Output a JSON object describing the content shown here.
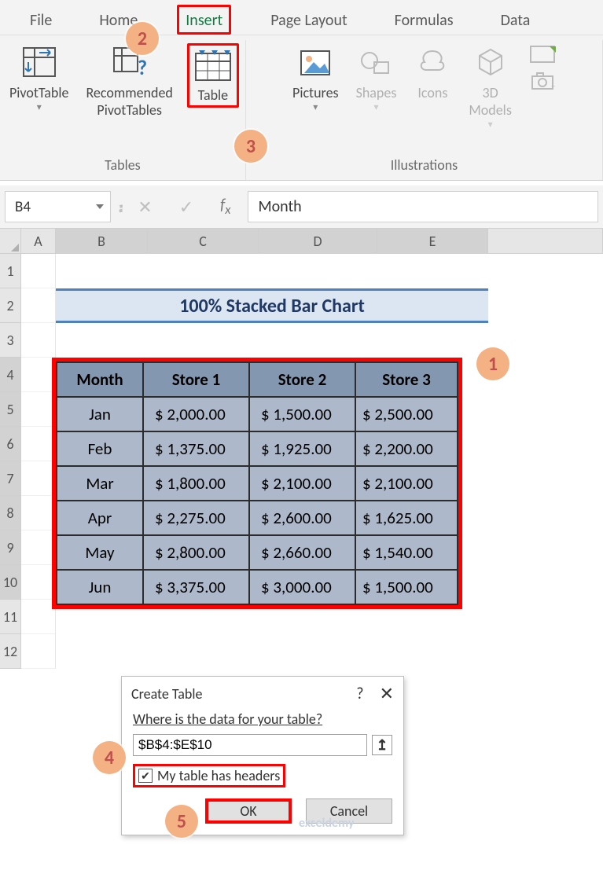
{
  "tabs": {
    "file": "File",
    "home": "Home",
    "insert": "Insert",
    "page_layout": "Page Layout",
    "formulas": "Formulas",
    "data": "Data"
  },
  "ribbon": {
    "tables_group_label": "Tables",
    "illustrations_group_label": "Illustrations",
    "pivot_table": "PivotTable",
    "recommended_pivot": "Recommended\nPivotTables",
    "table": "Table",
    "pictures": "Pictures",
    "shapes": "Shapes",
    "icons": "Icons",
    "models3d": "3D\nModels"
  },
  "name_box": "B4",
  "formula_value": "Month",
  "columns": {
    "A": "A",
    "B": "B",
    "C": "C",
    "D": "D",
    "E": "E"
  },
  "row_numbers": [
    "1",
    "2",
    "3",
    "4",
    "5",
    "6",
    "7",
    "8",
    "9",
    "10",
    "11",
    "12"
  ],
  "title": "100% Stacked Bar Chart",
  "table_headers": [
    "Month",
    "Store 1",
    "Store 2",
    "Store 3"
  ],
  "rows": [
    {
      "m": "Jan",
      "s1": "$   2,000.00",
      "s2": "$  1,500.00",
      "s3": "$ 2,500.00"
    },
    {
      "m": "Feb",
      "s1": "$   1,375.00",
      "s2": "$  1,925.00",
      "s3": "$ 2,200.00"
    },
    {
      "m": "Mar",
      "s1": "$   1,800.00",
      "s2": "$  2,100.00",
      "s3": "$ 2,100.00"
    },
    {
      "m": "Apr",
      "s1": "$   2,275.00",
      "s2": "$  2,600.00",
      "s3": "$ 1,625.00"
    },
    {
      "m": "May",
      "s1": "$   2,800.00",
      "s2": "$  2,660.00",
      "s3": "$ 1,540.00"
    },
    {
      "m": "Jun",
      "s1": "$   3,375.00",
      "s2": "$  3,000.00",
      "s3": "$ 1,500.00"
    }
  ],
  "dialog": {
    "title": "Create Table",
    "question": "Where is the data for your table?",
    "range": "$B$4:$E$10",
    "headers_label": "My table has headers",
    "ok": "OK",
    "cancel": "Cancel"
  },
  "steps": {
    "1": "1",
    "2": "2",
    "3": "3",
    "4": "4",
    "5": "5"
  },
  "watermark": "exceldemy",
  "chart_data": {
    "type": "table",
    "title": "100% Stacked Bar Chart",
    "columns": [
      "Month",
      "Store 1",
      "Store 2",
      "Store 3"
    ],
    "data": [
      [
        "Jan",
        2000.0,
        1500.0,
        2500.0
      ],
      [
        "Feb",
        1375.0,
        1925.0,
        2200.0
      ],
      [
        "Mar",
        1800.0,
        2100.0,
        2100.0
      ],
      [
        "Apr",
        2275.0,
        2600.0,
        1625.0
      ],
      [
        "May",
        2800.0,
        2660.0,
        1540.0
      ],
      [
        "Jun",
        3375.0,
        3000.0,
        1500.0
      ]
    ]
  }
}
